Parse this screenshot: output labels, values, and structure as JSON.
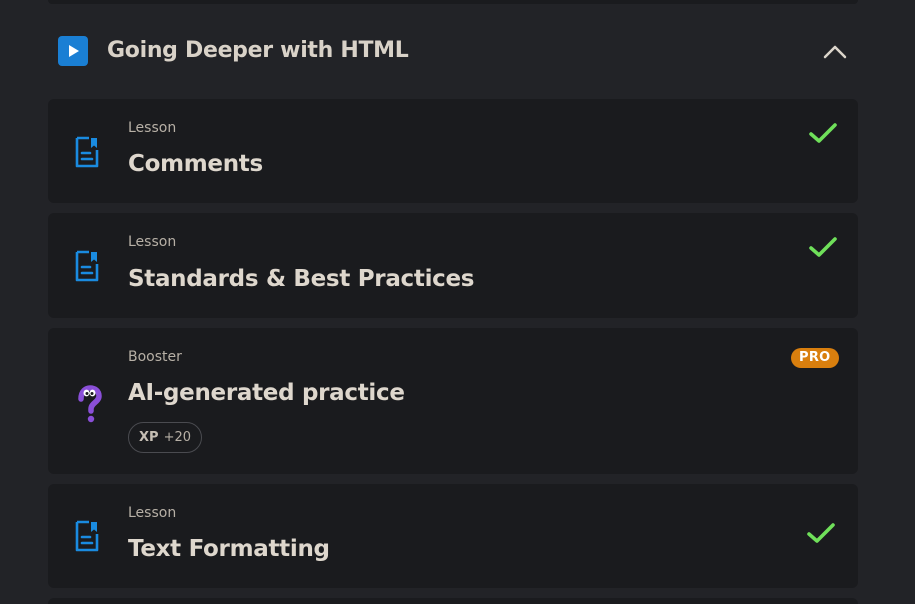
{
  "section": {
    "title": "Going Deeper with HTML",
    "icon": "play-icon",
    "accent_color": "#1a7fd4"
  },
  "items": [
    {
      "kind": "Lesson",
      "title": "Comments",
      "icon": "lesson-doc-icon",
      "completed": true
    },
    {
      "kind": "Lesson",
      "title": "Standards & Best Practices",
      "icon": "lesson-doc-icon",
      "completed": true
    },
    {
      "kind": "Booster",
      "title": "AI-generated practice",
      "icon": "question-mark-icon",
      "badge": "PRO",
      "xp_label": "XP",
      "xp_value": "+20"
    },
    {
      "kind": "Lesson",
      "title": "Text Formatting",
      "icon": "lesson-doc-icon",
      "completed": true
    }
  ],
  "colors": {
    "check": "#6fe05a",
    "pro_badge": "#d97f0e",
    "question_mark": "#8a4fd8"
  }
}
